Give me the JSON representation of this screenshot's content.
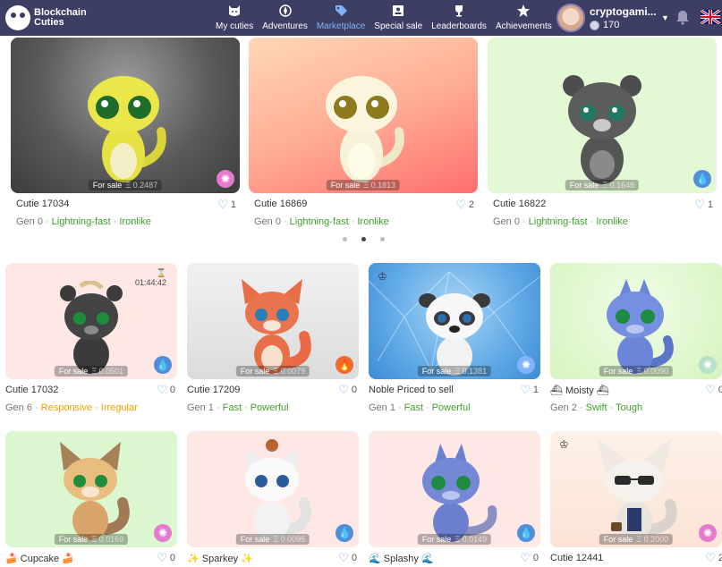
{
  "brand": {
    "line1": "Blockchain",
    "line2": "Cuties"
  },
  "nav": [
    {
      "label": "My cuties",
      "icon": "cat-face-icon"
    },
    {
      "label": "Adventures",
      "icon": "compass-icon"
    },
    {
      "label": "Marketplace",
      "icon": "tag-icon",
      "active": true
    },
    {
      "label": "Special sale",
      "icon": "id-card-icon"
    },
    {
      "label": "Leaderboards",
      "icon": "trophy-icon"
    },
    {
      "label": "Achievements",
      "icon": "star-icon"
    }
  ],
  "user": {
    "name": "cryptogami...",
    "balance": "170"
  },
  "colors": {
    "header": "#3c3f63",
    "accent": "#7fb3ff",
    "trait_green": "#3e9f2b",
    "trait_orange": "#f2a100",
    "like": "#6aa6e6"
  },
  "sale_label": "For sale",
  "featured": [
    {
      "name": "Cutie 17034",
      "likes": "1",
      "price": "Ξ 0.2487",
      "gen": "Gen 0",
      "trait1": "Lightning-fast",
      "trait2": "Ironlike",
      "element": "air"
    },
    {
      "name": "Cutie 16869",
      "likes": "2",
      "price": "Ξ 0.1813",
      "gen": "Gen 0",
      "trait1": "Lightning-fast",
      "trait2": "Ironlike",
      "element": ""
    },
    {
      "name": "Cutie 16822",
      "likes": "1",
      "price": "Ξ 0.1648",
      "gen": "Gen 0",
      "trait1": "Lightning-fast",
      "trait2": "Ironlike",
      "element": "water"
    }
  ],
  "grid": [
    {
      "name": "Cutie 17032",
      "likes": "0",
      "price": "Ξ 0.0501",
      "gen": "Gen 6",
      "trait1": "Responsive",
      "trait2": "Irregular",
      "timer": "01:44:42",
      "element": "water"
    },
    {
      "name": "Cutie 17209",
      "likes": "0",
      "price": "Ξ 0.0079",
      "gen": "Gen 1",
      "trait1": "Fast",
      "trait2": "Powerful",
      "element": "fire"
    },
    {
      "name": "Noble Priced to sell",
      "likes": "1",
      "price": "Ξ 0.1381",
      "gen": "Gen 1",
      "trait1": "Fast",
      "trait2": "Powerful",
      "element": "air"
    },
    {
      "name": "⛴ Moisty ⛴",
      "likes": "0",
      "price": "Ξ 0.0090",
      "gen": "Gen 2",
      "trait1": "Swift",
      "trait2": "Tough",
      "element": "air"
    },
    {
      "name": "🍰 Cupcake 🍰",
      "likes": "0",
      "price": "Ξ 0.0169",
      "element": "air"
    },
    {
      "name": "✨ Sparkey ✨",
      "likes": "0",
      "price": "Ξ 0.0095",
      "element": "water"
    },
    {
      "name": "🌊 Splashy 🌊",
      "likes": "0",
      "price": "Ξ 0.0149",
      "element": "water"
    },
    {
      "name": "Cutie 12441",
      "likes": "2",
      "price": "Ξ 0.2000",
      "element": "air"
    }
  ]
}
